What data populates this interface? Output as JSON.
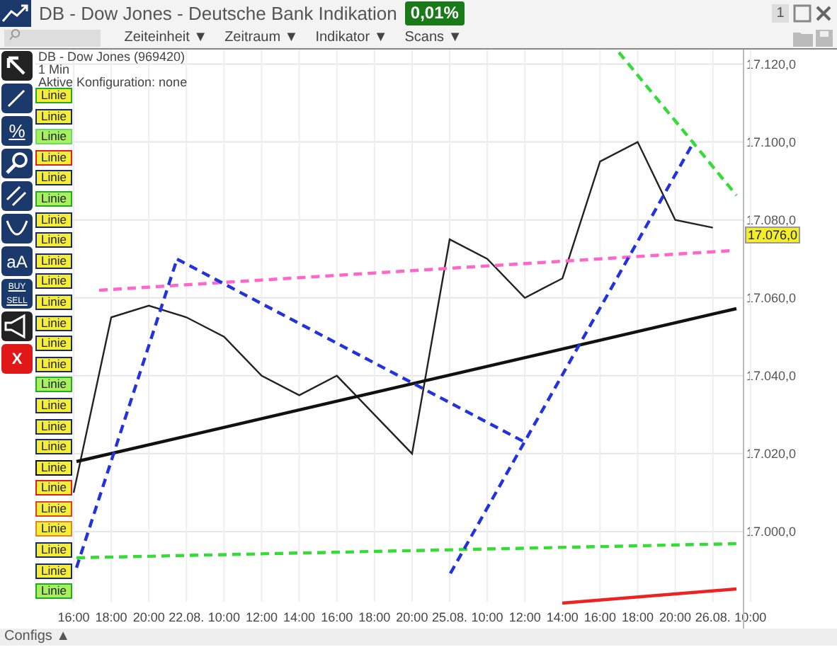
{
  "window": {
    "title": "DB - Dow Jones - Deutsche Bank Indikation",
    "change": "0,01%",
    "controls": [
      "1"
    ]
  },
  "toolbar": {
    "menus": [
      "Zeiteinheit ▼",
      "Zeitraum ▼",
      "Indikator ▼",
      "Scans ▼"
    ]
  },
  "tools": [
    {
      "kind": "pointer"
    },
    {
      "kind": "line"
    },
    {
      "kind": "percent",
      "label": "%"
    },
    {
      "kind": "zoom"
    },
    {
      "kind": "parallel"
    },
    {
      "kind": "curve"
    },
    {
      "kind": "text",
      "label": "aA"
    },
    {
      "kind": "trade",
      "label": "BUY",
      "label2": "SELL"
    },
    {
      "kind": "alert"
    },
    {
      "kind": "delete",
      "label": "X"
    }
  ],
  "chart_info": [
    "DB - Dow Jones (969420)",
    "1 Min",
    "Aktive Konfiguration: none"
  ],
  "drawings": [
    {
      "label": "Linie",
      "color": "#22aa22",
      "highlighted": false
    },
    {
      "label": "Linie",
      "color": "#1a2a6a",
      "highlighted": false
    },
    {
      "label": "Linie",
      "color": "#66dd66",
      "highlighted": true
    },
    {
      "label": "Linie",
      "color": "#dd2222",
      "highlighted": false
    },
    {
      "label": "Linie",
      "color": "#1a2a6a",
      "highlighted": false
    },
    {
      "label": "Linie",
      "color": "#22aa22",
      "highlighted": true
    },
    {
      "label": "Linie",
      "color": "#1a2a6a",
      "highlighted": false
    },
    {
      "label": "Linie",
      "color": "#1a2a6a",
      "highlighted": false
    },
    {
      "label": "Linie",
      "color": "#1a2a6a",
      "highlighted": false
    },
    {
      "label": "Linie",
      "color": "#1a2a6a",
      "highlighted": false
    },
    {
      "label": "Linie",
      "color": "#1a2a6a",
      "highlighted": false
    },
    {
      "label": "Linie",
      "color": "#1a2a6a",
      "highlighted": false
    },
    {
      "label": "Linie",
      "color": "#1a2a6a",
      "highlighted": false
    },
    {
      "label": "Linie",
      "color": "#1a2a6a",
      "highlighted": false
    },
    {
      "label": "Linie",
      "color": "#22aa22",
      "highlighted": true
    },
    {
      "label": "Linie",
      "color": "#1a2a6a",
      "highlighted": false
    },
    {
      "label": "Linie",
      "color": "#1a2a6a",
      "highlighted": false
    },
    {
      "label": "Linie",
      "color": "#1a2a6a",
      "highlighted": false
    },
    {
      "label": "Linie",
      "color": "#111111",
      "highlighted": false
    },
    {
      "label": "Linie",
      "color": "#dd2222",
      "highlighted": false
    },
    {
      "label": "Linie",
      "color": "#dd4422",
      "highlighted": false
    },
    {
      "label": "Linie",
      "color": "#dd8822",
      "highlighted": false
    },
    {
      "label": "Linie",
      "color": "#1a2a6a",
      "highlighted": false
    },
    {
      "label": "Linie",
      "color": "#1a2a6a",
      "highlighted": false
    },
    {
      "label": "Linie",
      "color": "#22aa22",
      "highlighted": true
    }
  ],
  "chart": {
    "current_price": "17.076,0",
    "chart_data": {
      "type": "line",
      "grid": true,
      "categories": [
        "16:00",
        "18:00",
        "20:00",
        "22.08.",
        "10:00",
        "12:00",
        "14:00",
        "16:00",
        "18:00",
        "20:00",
        "25.08.",
        "10:00",
        "12:00",
        "14:00",
        "16:00",
        "18:00",
        "20:00",
        "26.08.",
        "10:00"
      ],
      "series": [
        {
          "color": "#222222",
          "values": [
            17010,
            17055,
            17058,
            17055,
            17050,
            17040,
            17035,
            17040,
            17030,
            17020,
            17075,
            17070,
            17060,
            17065,
            17095,
            17100,
            17080,
            17078,
            null
          ]
        }
      ],
      "ylim": [
        16982,
        17123
      ],
      "yticks": [
        {
          "value": 17000,
          "label": "17.000,0"
        },
        {
          "value": 17020,
          "label": "17.020,0"
        },
        {
          "value": 17040,
          "label": "17.040,0"
        },
        {
          "value": 17060,
          "label": "17.060,0"
        },
        {
          "value": 17080,
          "label": "17.080,0"
        },
        {
          "value": 17100,
          "label": "17.100,0"
        },
        {
          "value": 17120,
          "label": "17.120,0"
        }
      ]
    }
  },
  "footer": {
    "configs": "Configs ▲"
  }
}
